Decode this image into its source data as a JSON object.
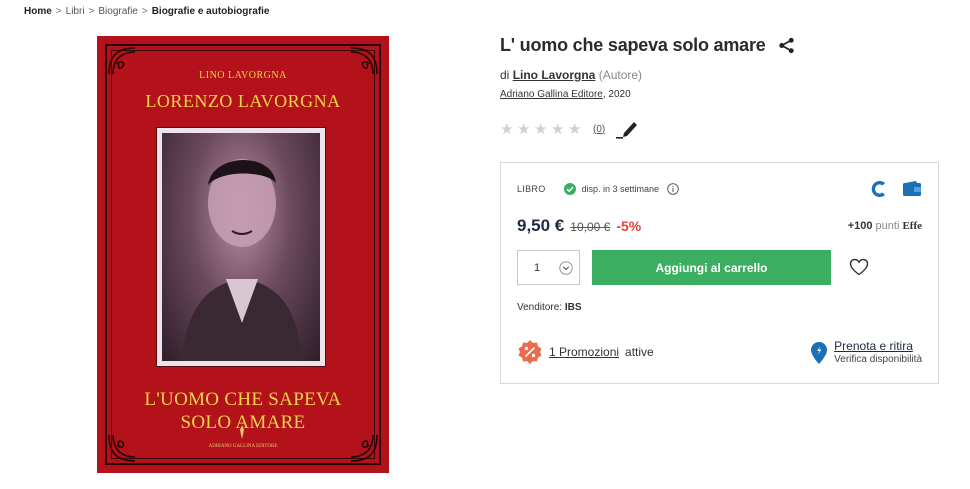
{
  "breadcrumb": {
    "items": [
      "Home",
      "Libri",
      "Biografie",
      "Biografie e autobiografie"
    ],
    "separator": ">"
  },
  "cover": {
    "author_small": "LINO LAVORGNA",
    "author_big": "LORENZO LAVORGNA",
    "title_line1": "L'UOMO CHE SAPEVA",
    "title_line2": "SOLO AMARE",
    "publisher": "ADRIANO GALLINA EDITORE",
    "colors": {
      "background": "#b3121b",
      "lettering": "#f1d34a"
    }
  },
  "product": {
    "title": "L' uomo che sapeva solo amare",
    "by_prefix": "di",
    "author": "Lino Lavorgna",
    "author_role": "(Autore)",
    "publisher": "Adriano Gallina Editore",
    "year": ", 2020",
    "rating": {
      "stars": 0,
      "max": 5,
      "count_label": "(0)"
    }
  },
  "buy_box": {
    "format": "LIBRO",
    "availability": "disp. in 3 settimane",
    "price_current": "9,50 €",
    "price_old": "10,00 €",
    "discount": "-5%",
    "points_number": "+100",
    "points_word": "punti",
    "points_brand": "Effe",
    "quantity": "1",
    "add_to_cart": "Aggiungi al carrello",
    "seller_label": "Venditore:",
    "seller_name": "IBS",
    "promotions_link": "1 Promozioni",
    "promotions_suffix": "attive",
    "pickup_link": "Prenota e ritira",
    "pickup_sub": "Verifica disponibilità"
  },
  "colors": {
    "accent_green": "#3cae62",
    "discount_red": "#e0443a",
    "availability_green": "#3cae62",
    "brand_blue": "#1a6fb5",
    "promo_orange": "#ec6b4a"
  },
  "icons": [
    "share-icon",
    "star-icon",
    "pen-icon",
    "check-icon",
    "info-icon",
    "ebook-c-icon",
    "wallet-icon",
    "chevron-down-icon",
    "heart-icon",
    "percent-icon",
    "location-pin-icon"
  ]
}
